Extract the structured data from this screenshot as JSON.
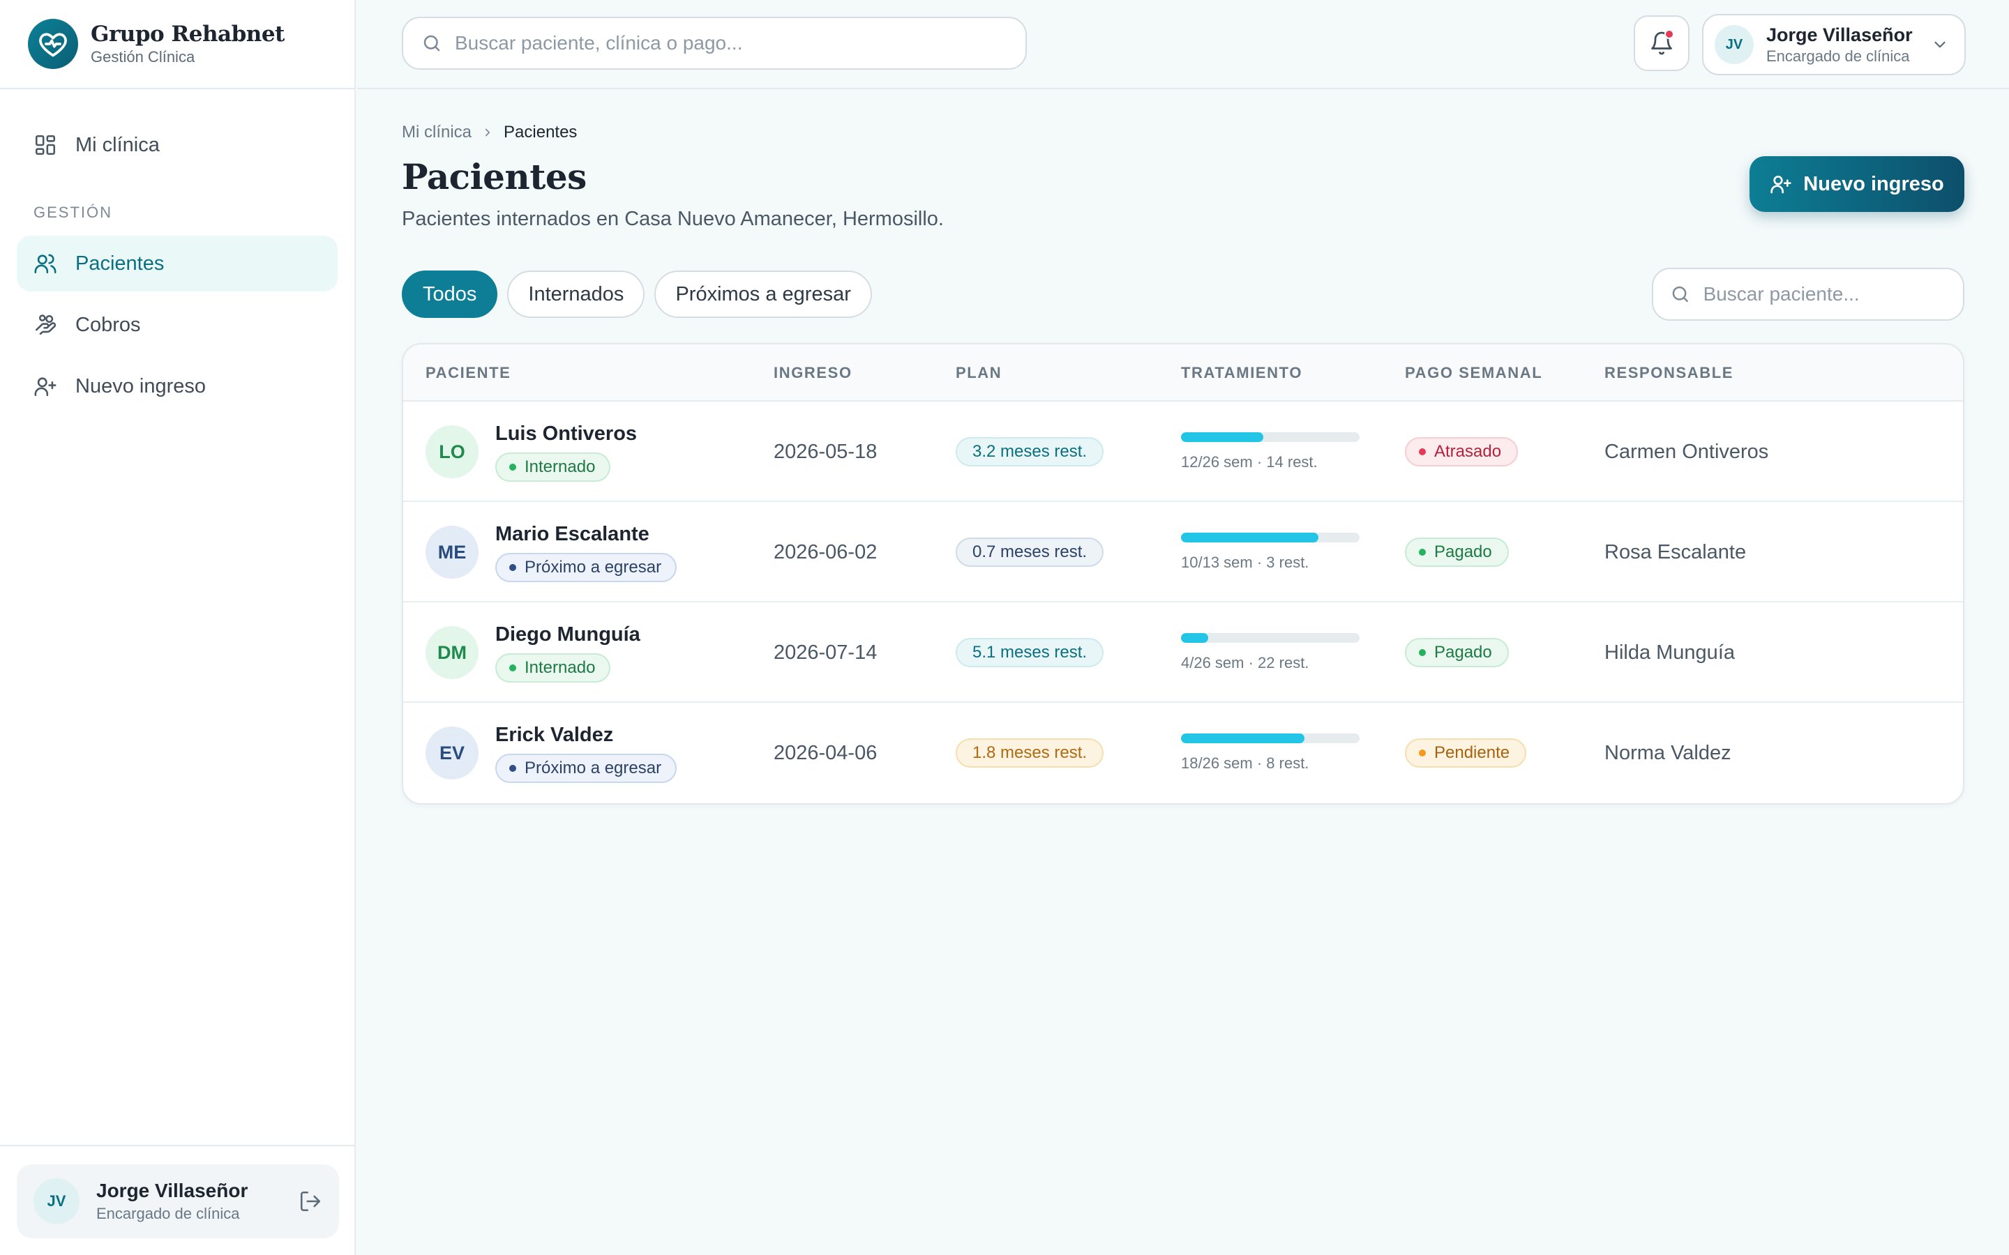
{
  "brand": {
    "name": "Grupo Rehabnet",
    "subtitle": "Gestión Clínica",
    "logo_icon": "heart-pulse-icon",
    "accent": "#0d7e95"
  },
  "sidebar": {
    "items": [
      {
        "label": "Mi clínica",
        "icon": "dashboard-icon",
        "active": false
      }
    ],
    "section_label": "GESTIÓN",
    "section_items": [
      {
        "label": "Pacientes",
        "icon": "users-icon",
        "active": true
      },
      {
        "label": "Cobros",
        "icon": "hand-coins-icon",
        "active": false
      },
      {
        "label": "Nuevo ingreso",
        "icon": "user-plus-icon",
        "active": false
      }
    ],
    "user": {
      "initials": "JV",
      "name": "Jorge Villaseñor",
      "role": "Encargado de clínica"
    }
  },
  "topbar": {
    "search_placeholder": "Buscar paciente, clínica o pago...",
    "notifications": {
      "has_unread": true
    },
    "user": {
      "initials": "JV",
      "name": "Jorge Villaseñor",
      "role": "Encargado de clínica"
    }
  },
  "breadcrumb": {
    "parent": "Mi clínica",
    "current": "Pacientes"
  },
  "page": {
    "title": "Pacientes",
    "subtitle": "Pacientes internados en Casa Nuevo Amanecer, Hermosillo.",
    "new_button": "Nuevo ingreso"
  },
  "filters": {
    "tabs": [
      "Todos",
      "Internados",
      "Próximos a egresar"
    ],
    "active": "Todos",
    "search_placeholder": "Buscar paciente..."
  },
  "table": {
    "columns": [
      "PACIENTE",
      "INGRESO",
      "PLAN",
      "TRATAMIENTO",
      "PAGO SEMANAL",
      "RESPONSABLE"
    ],
    "rows": [
      {
        "initials": "LO",
        "name": "Luis Ontiveros",
        "status": "Internado",
        "status_color": "green",
        "ingreso": "2026-05-18",
        "plan": "3.2 meses rest.",
        "plan_color": "teal",
        "progress": 0.4615,
        "progress_label": "12/26 sem · 14 rest.",
        "pago": "Atrasado",
        "pago_color": "red",
        "responsable": "Carmen Ontiveros"
      },
      {
        "initials": "ME",
        "name": "Mario Escalante",
        "status": "Próximo a egresar",
        "status_color": "blue",
        "ingreso": "2026-06-02",
        "plan": "0.7 meses rest.",
        "plan_color": "slate",
        "progress": 0.7692,
        "progress_label": "10/13 sem · 3 rest.",
        "pago": "Pagado",
        "pago_color": "green",
        "responsable": "Rosa Escalante"
      },
      {
        "initials": "DM",
        "name": "Diego Munguía",
        "status": "Internado",
        "status_color": "green",
        "ingreso": "2026-07-14",
        "plan": "5.1 meses rest.",
        "plan_color": "teal",
        "progress": 0.1538,
        "progress_label": "4/26 sem · 22 rest.",
        "pago": "Pagado",
        "pago_color": "green",
        "responsable": "Hilda Munguía"
      },
      {
        "initials": "EV",
        "name": "Erick Valdez",
        "status": "Próximo a egresar",
        "status_color": "blue",
        "ingreso": "2026-04-06",
        "plan": "1.8 meses rest.",
        "plan_color": "amber",
        "progress": 0.6923,
        "progress_label": "18/26 sem · 8 rest.",
        "pago": "Pendiente",
        "pago_color": "amber",
        "responsable": "Norma Valdez"
      }
    ]
  }
}
